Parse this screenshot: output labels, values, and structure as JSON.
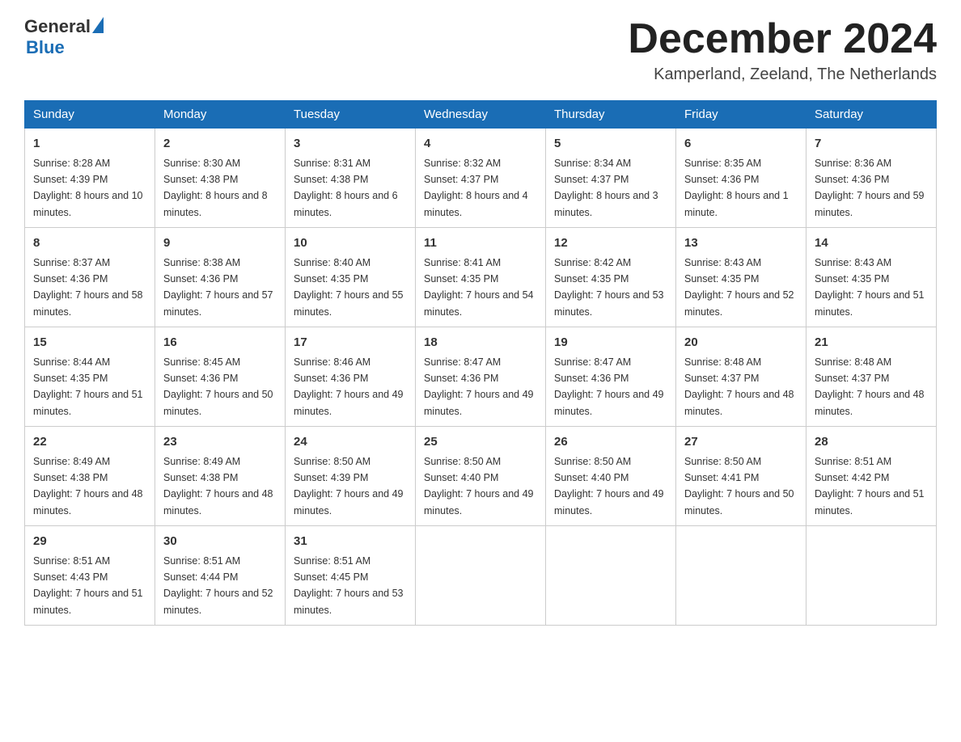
{
  "header": {
    "logo": {
      "general": "General",
      "blue": "Blue",
      "tagline": ""
    },
    "title": "December 2024",
    "subtitle": "Kamperland, Zeeland, The Netherlands"
  },
  "calendar": {
    "days_of_week": [
      "Sunday",
      "Monday",
      "Tuesday",
      "Wednesday",
      "Thursday",
      "Friday",
      "Saturday"
    ],
    "weeks": [
      [
        {
          "day": "1",
          "sunrise": "8:28 AM",
          "sunset": "4:39 PM",
          "daylight": "8 hours and 10 minutes."
        },
        {
          "day": "2",
          "sunrise": "8:30 AM",
          "sunset": "4:38 PM",
          "daylight": "8 hours and 8 minutes."
        },
        {
          "day": "3",
          "sunrise": "8:31 AM",
          "sunset": "4:38 PM",
          "daylight": "8 hours and 6 minutes."
        },
        {
          "day": "4",
          "sunrise": "8:32 AM",
          "sunset": "4:37 PM",
          "daylight": "8 hours and 4 minutes."
        },
        {
          "day": "5",
          "sunrise": "8:34 AM",
          "sunset": "4:37 PM",
          "daylight": "8 hours and 3 minutes."
        },
        {
          "day": "6",
          "sunrise": "8:35 AM",
          "sunset": "4:36 PM",
          "daylight": "8 hours and 1 minute."
        },
        {
          "day": "7",
          "sunrise": "8:36 AM",
          "sunset": "4:36 PM",
          "daylight": "7 hours and 59 minutes."
        }
      ],
      [
        {
          "day": "8",
          "sunrise": "8:37 AM",
          "sunset": "4:36 PM",
          "daylight": "7 hours and 58 minutes."
        },
        {
          "day": "9",
          "sunrise": "8:38 AM",
          "sunset": "4:36 PM",
          "daylight": "7 hours and 57 minutes."
        },
        {
          "day": "10",
          "sunrise": "8:40 AM",
          "sunset": "4:35 PM",
          "daylight": "7 hours and 55 minutes."
        },
        {
          "day": "11",
          "sunrise": "8:41 AM",
          "sunset": "4:35 PM",
          "daylight": "7 hours and 54 minutes."
        },
        {
          "day": "12",
          "sunrise": "8:42 AM",
          "sunset": "4:35 PM",
          "daylight": "7 hours and 53 minutes."
        },
        {
          "day": "13",
          "sunrise": "8:43 AM",
          "sunset": "4:35 PM",
          "daylight": "7 hours and 52 minutes."
        },
        {
          "day": "14",
          "sunrise": "8:43 AM",
          "sunset": "4:35 PM",
          "daylight": "7 hours and 51 minutes."
        }
      ],
      [
        {
          "day": "15",
          "sunrise": "8:44 AM",
          "sunset": "4:35 PM",
          "daylight": "7 hours and 51 minutes."
        },
        {
          "day": "16",
          "sunrise": "8:45 AM",
          "sunset": "4:36 PM",
          "daylight": "7 hours and 50 minutes."
        },
        {
          "day": "17",
          "sunrise": "8:46 AM",
          "sunset": "4:36 PM",
          "daylight": "7 hours and 49 minutes."
        },
        {
          "day": "18",
          "sunrise": "8:47 AM",
          "sunset": "4:36 PM",
          "daylight": "7 hours and 49 minutes."
        },
        {
          "day": "19",
          "sunrise": "8:47 AM",
          "sunset": "4:36 PM",
          "daylight": "7 hours and 49 minutes."
        },
        {
          "day": "20",
          "sunrise": "8:48 AM",
          "sunset": "4:37 PM",
          "daylight": "7 hours and 48 minutes."
        },
        {
          "day": "21",
          "sunrise": "8:48 AM",
          "sunset": "4:37 PM",
          "daylight": "7 hours and 48 minutes."
        }
      ],
      [
        {
          "day": "22",
          "sunrise": "8:49 AM",
          "sunset": "4:38 PM",
          "daylight": "7 hours and 48 minutes."
        },
        {
          "day": "23",
          "sunrise": "8:49 AM",
          "sunset": "4:38 PM",
          "daylight": "7 hours and 48 minutes."
        },
        {
          "day": "24",
          "sunrise": "8:50 AM",
          "sunset": "4:39 PM",
          "daylight": "7 hours and 49 minutes."
        },
        {
          "day": "25",
          "sunrise": "8:50 AM",
          "sunset": "4:40 PM",
          "daylight": "7 hours and 49 minutes."
        },
        {
          "day": "26",
          "sunrise": "8:50 AM",
          "sunset": "4:40 PM",
          "daylight": "7 hours and 49 minutes."
        },
        {
          "day": "27",
          "sunrise": "8:50 AM",
          "sunset": "4:41 PM",
          "daylight": "7 hours and 50 minutes."
        },
        {
          "day": "28",
          "sunrise": "8:51 AM",
          "sunset": "4:42 PM",
          "daylight": "7 hours and 51 minutes."
        }
      ],
      [
        {
          "day": "29",
          "sunrise": "8:51 AM",
          "sunset": "4:43 PM",
          "daylight": "7 hours and 51 minutes."
        },
        {
          "day": "30",
          "sunrise": "8:51 AM",
          "sunset": "4:44 PM",
          "daylight": "7 hours and 52 minutes."
        },
        {
          "day": "31",
          "sunrise": "8:51 AM",
          "sunset": "4:45 PM",
          "daylight": "7 hours and 53 minutes."
        },
        null,
        null,
        null,
        null
      ]
    ]
  }
}
